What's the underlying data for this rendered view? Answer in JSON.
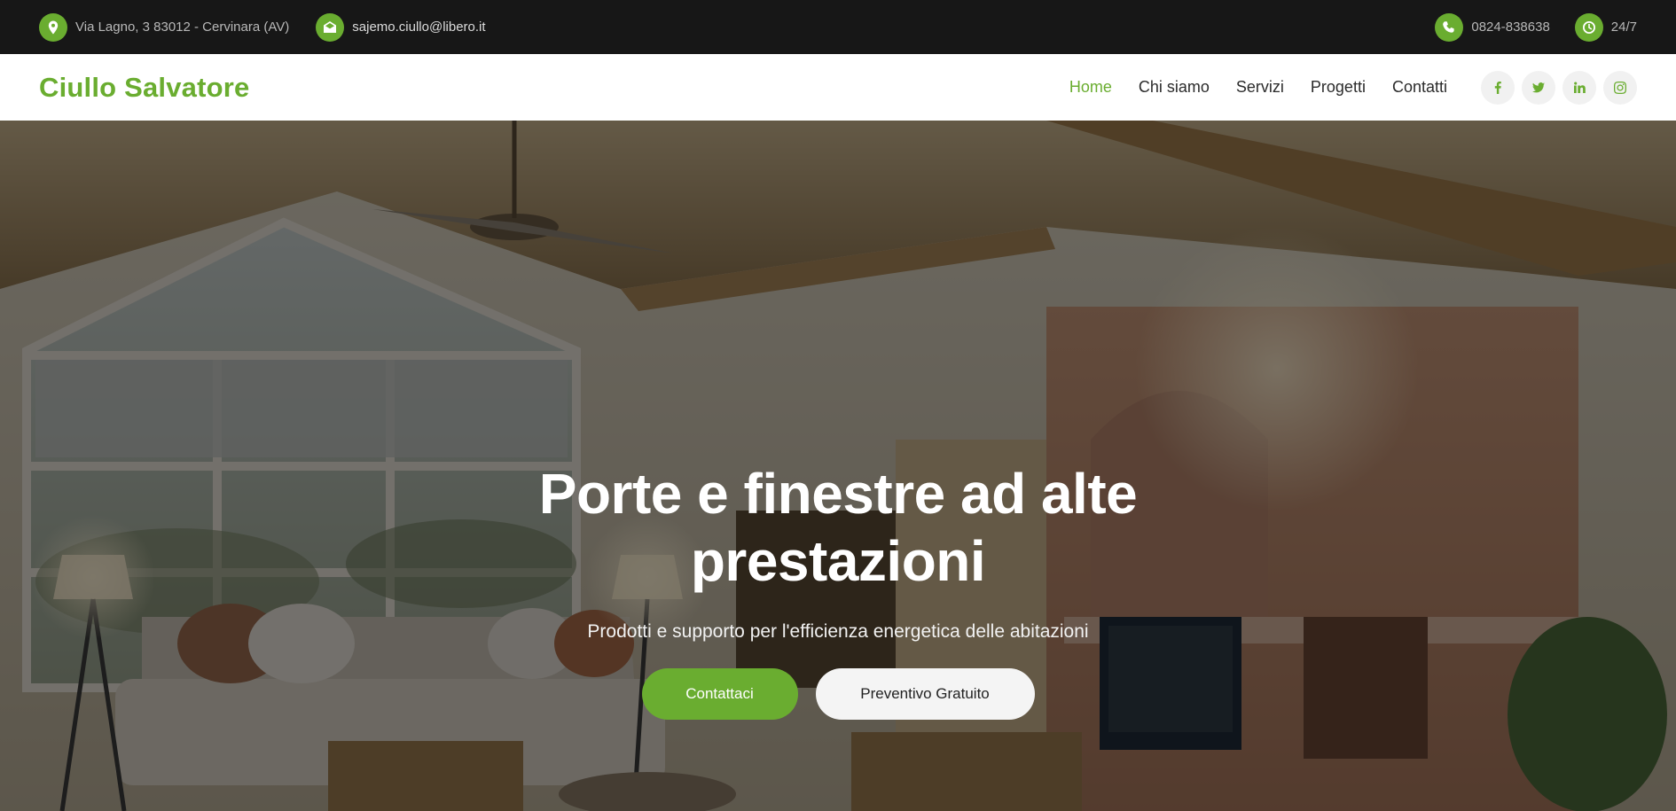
{
  "topbar": {
    "address": "Via Lagno, 3 83012 - Cervinara (AV)",
    "email": "sajemo.ciullo@libero.it",
    "phone": "0824-838638",
    "hours": "24/7",
    "icons": [
      "map-pin-icon",
      "envelope-open-icon",
      "phone-icon",
      "clock-icon"
    ]
  },
  "navbar": {
    "brand": "Ciullo Salvatore",
    "links": [
      {
        "label": "Home",
        "active": true
      },
      {
        "label": "Chi siamo",
        "active": false
      },
      {
        "label": "Servizi",
        "active": false
      },
      {
        "label": "Progetti",
        "active": false
      },
      {
        "label": "Contatti",
        "active": false
      }
    ],
    "social_icons": [
      "facebook-icon",
      "twitter-icon",
      "linkedin-icon",
      "instagram-icon"
    ]
  },
  "hero": {
    "title_line1": "Porte e finestre ad alte",
    "title_line2": "prestazioni",
    "subtitle": "Prodotti e supporto per l'efficienza energetica delle abitazioni",
    "primary_button": "Contattaci",
    "secondary_button": "Preventivo Gratuito"
  },
  "colors": {
    "accent": "#6aad30",
    "topbar_bg": "#171717",
    "nav_bg": "#ffffff",
    "text_dark": "#2b2b2b"
  }
}
